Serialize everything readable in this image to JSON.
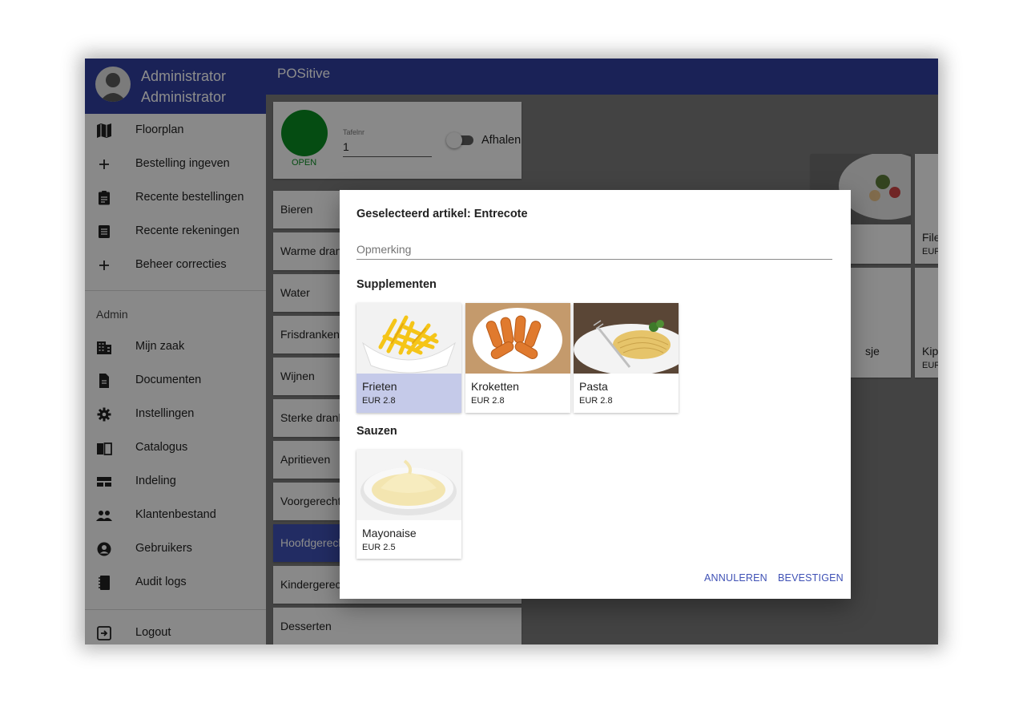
{
  "user": {
    "first_name": "Administrator",
    "last_name": "Administrator"
  },
  "app": {
    "title": "POSitive"
  },
  "nav": {
    "items": [
      {
        "label": "Floorplan",
        "icon": "map-icon"
      },
      {
        "label": "Bestelling ingeven",
        "icon": "plus-icon"
      },
      {
        "label": "Recente bestellingen",
        "icon": "clipboard-icon"
      },
      {
        "label": "Recente rekeningen",
        "icon": "receipt-icon"
      },
      {
        "label": "Beheer correcties",
        "icon": "plus-icon"
      }
    ],
    "admin_label": "Admin",
    "admin_items": [
      {
        "label": "Mijn zaak",
        "icon": "building-icon"
      },
      {
        "label": "Documenten",
        "icon": "document-icon"
      },
      {
        "label": "Instellingen",
        "icon": "gear-icon"
      },
      {
        "label": "Catalogus",
        "icon": "book-icon"
      },
      {
        "label": "Indeling",
        "icon": "layout-icon"
      },
      {
        "label": "Klantenbestand",
        "icon": "people-icon"
      },
      {
        "label": "Gebruikers",
        "icon": "account-icon"
      },
      {
        "label": "Audit logs",
        "icon": "notebook-icon"
      }
    ],
    "logout_label": "Logout"
  },
  "order": {
    "status": "OPEN",
    "status_color": "#0a8a22",
    "table_label": "Tafelnr",
    "table_value": "1",
    "takeaway_label": "Afhalen",
    "takeaway_on": false
  },
  "categories": [
    "Bieren",
    "Warme dranken",
    "Water",
    "Frisdranken",
    "Wijnen",
    "Sterke dranken",
    "Apritieven",
    "Voorgerechten",
    "Hoofdgerechten",
    "Kindergerechten",
    "Desserten"
  ],
  "active_category": "Hoofdgerechten",
  "background_products": [
    {
      "name": "File",
      "price": "EUR"
    },
    {
      "name": "sje",
      "price": ""
    },
    {
      "name": "Kip",
      "price": "EUR"
    }
  ],
  "dialog": {
    "title": "Geselecteerd artikel: Entrecote",
    "remark_placeholder": "Opmerking",
    "remark_value": "",
    "supplements_title": "Supplementen",
    "supplements": [
      {
        "name": "Frieten",
        "price": "EUR 2.8",
        "selected": true
      },
      {
        "name": "Kroketten",
        "price": "EUR 2.8",
        "selected": false
      },
      {
        "name": "Pasta",
        "price": "EUR 2.8",
        "selected": false
      }
    ],
    "sauces_title": "Sauzen",
    "sauces": [
      {
        "name": "Mayonaise",
        "price": "EUR 2.5",
        "selected": false
      }
    ],
    "cancel_label": "ANNULEREN",
    "confirm_label": "BEVESTIGEN"
  },
  "colors": {
    "primary": "#303f9f",
    "accent": "#3f51b5",
    "selected": "#c5cae9"
  }
}
